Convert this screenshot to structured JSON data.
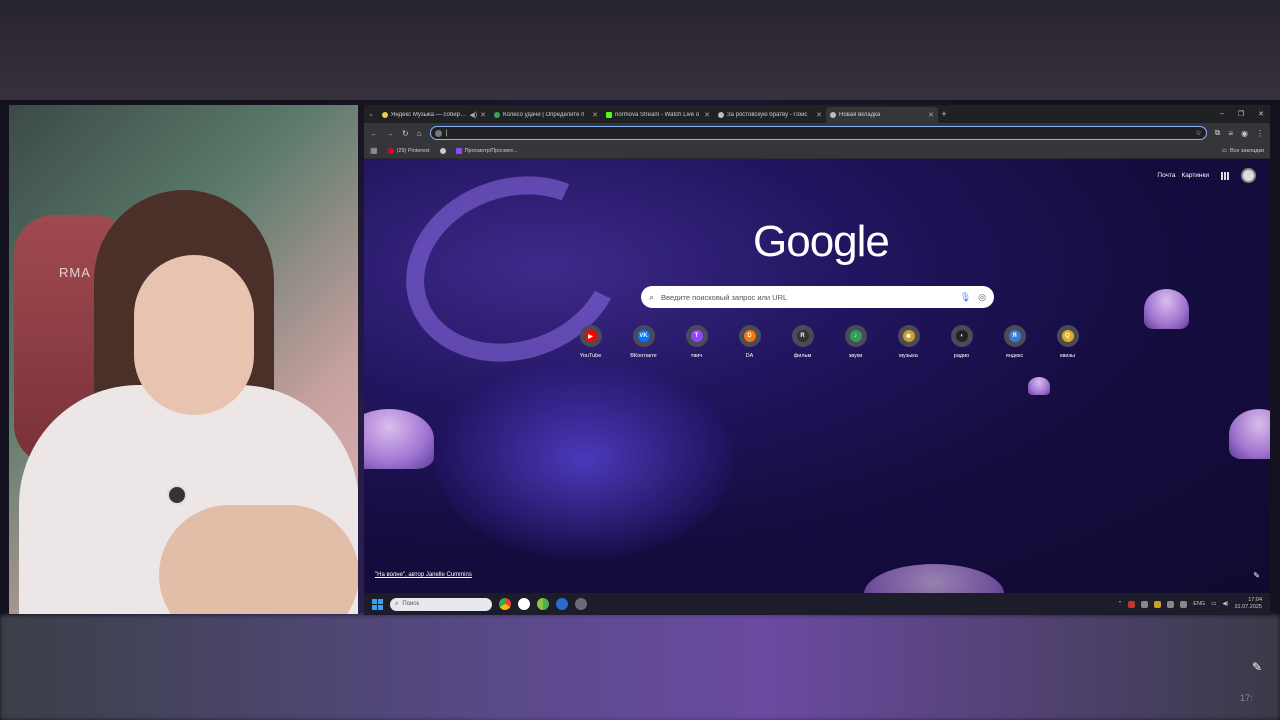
{
  "tabs": [
    {
      "title": "Яндекс Музыка — собираем",
      "color": "#f2c94c"
    },
    {
      "title": "Колесо удачи | Определите п",
      "color": "#34a853"
    },
    {
      "title": "normova Stream - Watch Live o",
      "color": "#53fc18"
    },
    {
      "title": "За ростовскую братву - Поис",
      "color": "#bbbbbb"
    },
    {
      "title": "Новая вкладка",
      "color": "#bbbbbb"
    }
  ],
  "bookmarks": {
    "items": [
      {
        "label": "(29) Pinterest",
        "color": "#e60023"
      },
      {
        "label": "",
        "color": "#cccccc"
      },
      {
        "label": "Просмотр/Просмот...",
        "color": "#9146ff"
      }
    ],
    "all_label": "Все закладки"
  },
  "ntp": {
    "mail_link": "Почта",
    "images_link": "Картинки",
    "logo": "Google",
    "search_placeholder": "Введите поисковый запрос или URL",
    "credit": "\"На волне\", автор Janelle Cummins"
  },
  "shortcuts": [
    {
      "label": "YouTube",
      "icon": "youtube-icon",
      "color": "#ff0000",
      "glyph": "▶"
    },
    {
      "label": "ВКонтакте",
      "icon": "vk-icon",
      "color": "#0077ff",
      "glyph": "VK"
    },
    {
      "label": "твич",
      "icon": "twitch-icon",
      "color": "#9146ff",
      "glyph": "T"
    },
    {
      "label": "DA",
      "icon": "donationalerts-icon",
      "color": "#f57507",
      "glyph": "D"
    },
    {
      "label": "фильм",
      "icon": "film-icon",
      "color": "#333333",
      "glyph": "R"
    },
    {
      "label": "звуки",
      "icon": "sounds-icon",
      "color": "#2e9e5b",
      "glyph": "♪"
    },
    {
      "label": "музыка",
      "icon": "music-icon",
      "color": "#c9a227",
      "glyph": "✱"
    },
    {
      "label": "радио",
      "icon": "radio-icon",
      "color": "#222222",
      "glyph": "◗"
    },
    {
      "label": "яндекс",
      "icon": "yandex-icon",
      "color": "#3a7bd5",
      "glyph": "Я"
    },
    {
      "label": "квизы",
      "icon": "quiz-icon",
      "color": "#e0b020",
      "glyph": "Q"
    }
  ],
  "taskbar": {
    "search_placeholder": "Поиск",
    "lang": "ENG",
    "time": "17:04",
    "date": "31.07.2025"
  },
  "webcam": {
    "chair_text": "RMA"
  },
  "corner_time": "17:"
}
